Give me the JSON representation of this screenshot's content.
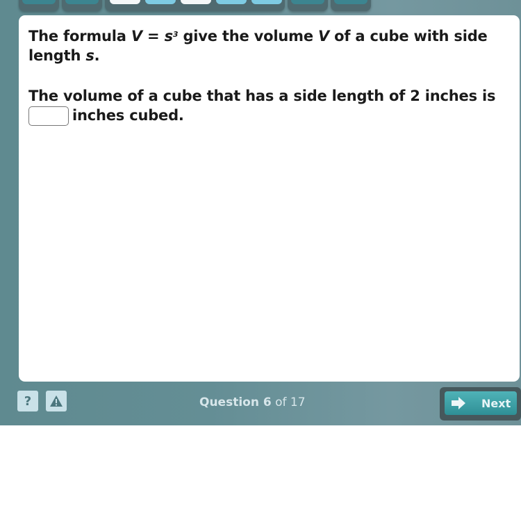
{
  "question": {
    "line1_pre": "The formula ",
    "var_v": "V",
    "equals": " = ",
    "var_s": "s",
    "exponent": "3",
    "line1_mid": " give the volume ",
    "var_v2": "V",
    "line1_post": " of a cube with side length ",
    "var_s2": "s",
    "line1_end": ".",
    "line2_pre": "The volume of a cube that has a side length of 2 inches is ",
    "answer_value": "",
    "line2_post": "inches cubed."
  },
  "footer": {
    "help_icon": "?",
    "progress_word": "Question ",
    "current": "6",
    "of_word": " of ",
    "total": "17",
    "next_label": "Next"
  },
  "colors": {
    "nav_dark": "#3c8590",
    "nav_light": "#7ecbe3",
    "nav_white": "#f4f7f8",
    "next_button": "#2f8f96"
  }
}
